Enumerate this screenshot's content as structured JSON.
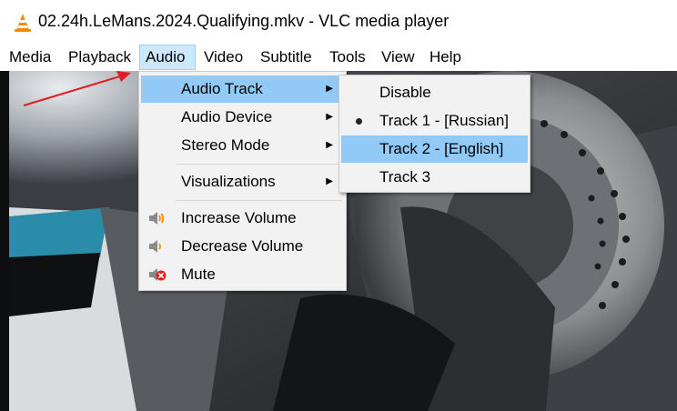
{
  "window": {
    "title": "02.24h.LeMans.2024.Qualifying.mkv - VLC media player"
  },
  "menubar": [
    {
      "label": "Media"
    },
    {
      "label": "Playback"
    },
    {
      "label": "Audio"
    },
    {
      "label": "Video"
    },
    {
      "label": "Subtitle"
    },
    {
      "label": "Tools"
    },
    {
      "label": "View"
    },
    {
      "label": "Help"
    }
  ],
  "audio_menu": {
    "items": [
      {
        "label": "Audio Track",
        "submenu": true
      },
      {
        "label": "Audio Device",
        "submenu": true
      },
      {
        "label": "Stereo Mode",
        "submenu": true
      },
      {
        "label": "Visualizations",
        "submenu": true
      },
      {
        "label": "Increase Volume",
        "icon": "volume-up-icon"
      },
      {
        "label": "Decrease Volume",
        "icon": "volume-down-icon"
      },
      {
        "label": "Mute",
        "icon": "mute-icon"
      }
    ],
    "submenu_arrow": "▶"
  },
  "audio_track_submenu": {
    "items": [
      {
        "label": "Disable"
      },
      {
        "label": "Track 1 - [Russian]",
        "selected": true
      },
      {
        "label": "Track 2 - [English]",
        "highlighted": true
      },
      {
        "label": "Track 3"
      }
    ]
  },
  "colors": {
    "menu_bg": "#f2f2f2",
    "highlight": "#91c9f7",
    "menubar_active": "#cce8ff",
    "vlc_orange": "#f48b00",
    "annotation_arrow": "#e02020"
  }
}
